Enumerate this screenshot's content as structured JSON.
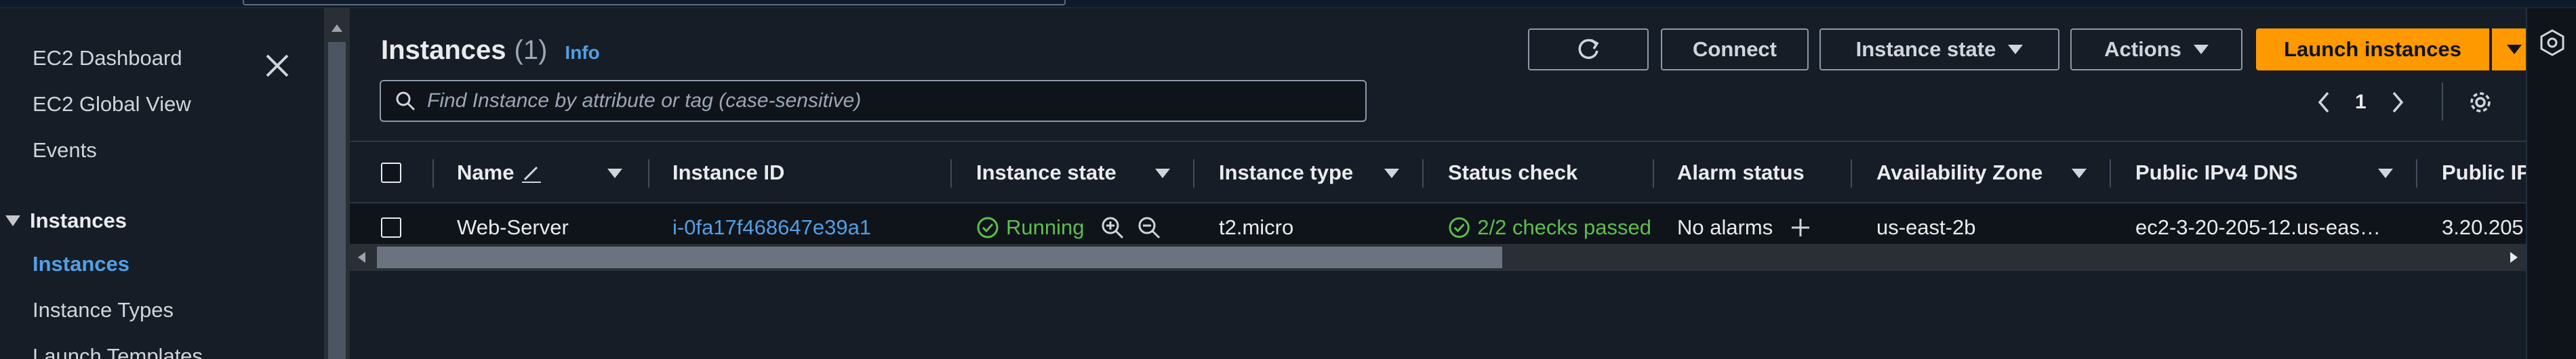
{
  "sidebar": {
    "items": [
      {
        "label": "EC2 Dashboard"
      },
      {
        "label": "EC2 Global View"
      },
      {
        "label": "Events"
      }
    ],
    "section": {
      "label": "Instances"
    },
    "section_items": [
      {
        "label": "Instances",
        "active": true
      },
      {
        "label": "Instance Types"
      },
      {
        "label": "Launch Templates"
      }
    ]
  },
  "header": {
    "title": "Instances",
    "count": "(1)",
    "info": "Info"
  },
  "toolbar": {
    "connect": "Connect",
    "instance_state": "Instance state",
    "actions": "Actions",
    "launch": "Launch instances"
  },
  "search": {
    "placeholder": "Find Instance by attribute or tag (case-sensitive)",
    "value": ""
  },
  "pagination": {
    "page": "1"
  },
  "table": {
    "columns": [
      {
        "label": "Name"
      },
      {
        "label": "Instance ID"
      },
      {
        "label": "Instance state"
      },
      {
        "label": "Instance type"
      },
      {
        "label": "Status check"
      },
      {
        "label": "Alarm status"
      },
      {
        "label": "Availability Zone"
      },
      {
        "label": "Public IPv4 DNS"
      },
      {
        "label": "Public IP"
      }
    ],
    "rows": [
      {
        "name": "Web-Server",
        "instance_id": "i-0fa17f468647e39a1",
        "state": "Running",
        "type": "t2.micro",
        "status_check": "2/2 checks passed",
        "alarm_status": "No alarms",
        "az": "us-east-2b",
        "dns": "ec2-3-20-205-12.us-eas…",
        "public_ip": "3.20.205"
      }
    ]
  },
  "colors": {
    "accent": "#539fe5",
    "primary_button": "#ff9900",
    "success": "#5fbe4f"
  }
}
